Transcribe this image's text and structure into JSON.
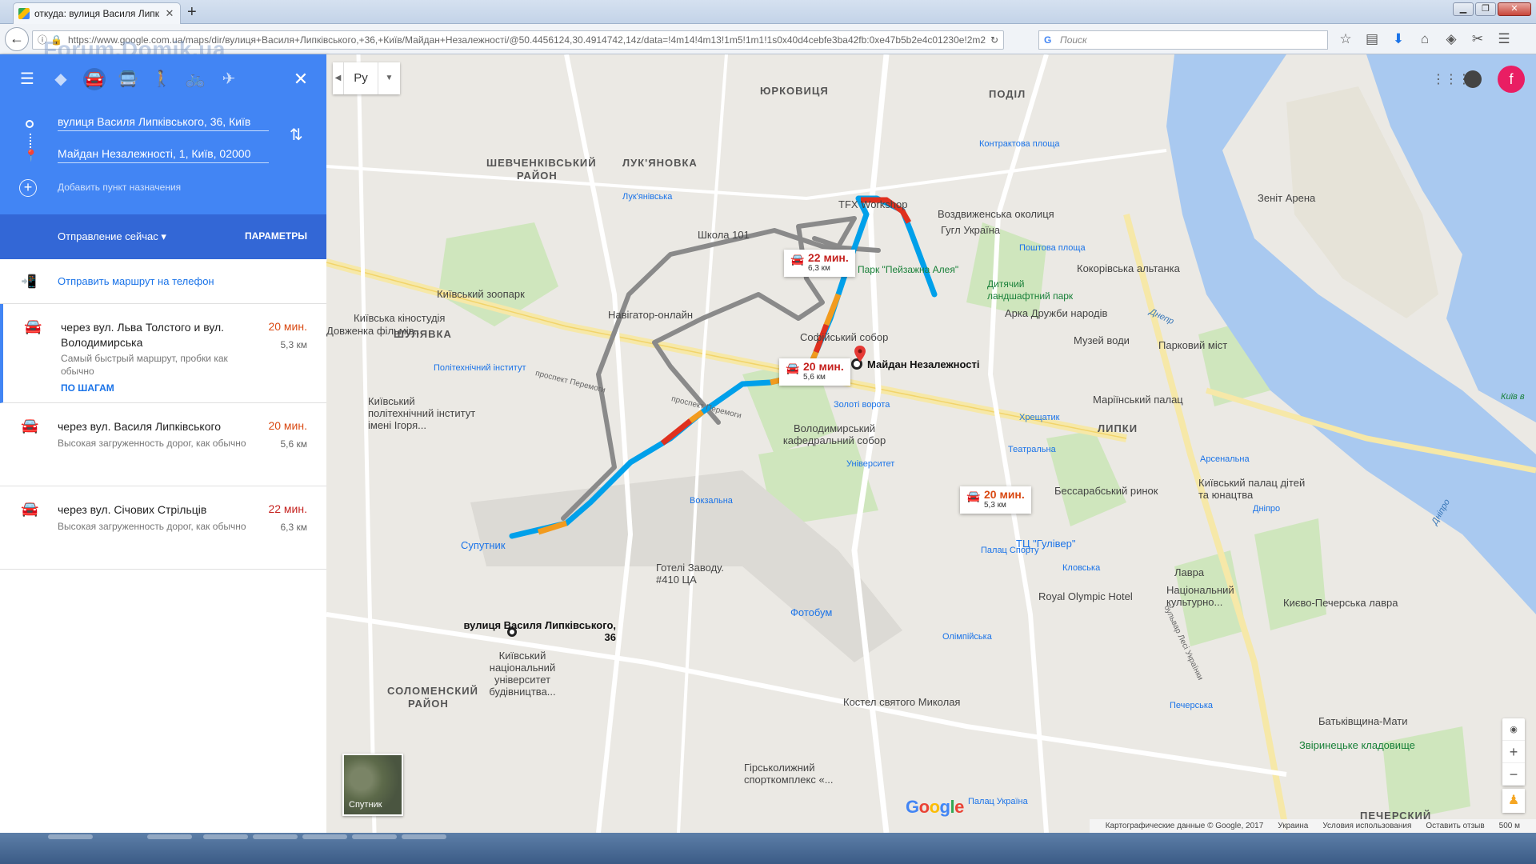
{
  "browser": {
    "tab_title": "откуда: вулиця Василя Липк",
    "url": "https://www.google.com.ua/maps/dir/вулиця+Василя+Липківського,+36,+Київ/Майдан+Незалежності/@50.4456124,30.4914742,14z/data=!4m14!4m13!1m5!1m1!1s0x40d4cebfe3ba42fb:0xe47b5b2e4c01230e!2m2!1d",
    "search_placeholder": "Поиск",
    "watermark": "Forum.Domik.ua"
  },
  "directions": {
    "origin": "вулиця Василя Липківського, 36, Київ",
    "destination": "Майдан Незалежності, 1, Київ, 02000",
    "add_destination": "Добавить пункт назначения",
    "depart": "Отправление сейчас",
    "options": "ПАРАМЕТРЫ",
    "send_to_phone": "Отправить маршрут на телефон",
    "routes": [
      {
        "name": "через вул. Льва Толстого и вул. Володимирська",
        "time": "20 мин.",
        "distance": "5,3 км",
        "desc": "Самый быстрый маршрут, пробки как обычно",
        "steps": "ПО ШАГАМ"
      },
      {
        "name": "через вул. Василя Липківського",
        "time": "20 мин.",
        "distance": "5,6 км",
        "desc": "Высокая загруженность дорог, как обычно"
      },
      {
        "name": "через вул. Січових Стрільців",
        "time": "22 мин.",
        "distance": "6,3 км",
        "desc": "Высокая загруженность дорог, как обычно"
      }
    ]
  },
  "map": {
    "language": "Ру",
    "avatar_letter": "f",
    "satellite_label": "Спутник",
    "google": [
      "G",
      "o",
      "o",
      "g",
      "l",
      "e"
    ],
    "footer": [
      "Картографические данные © Google, 2017",
      "Украина",
      "Условия использования",
      "Оставить отзыв",
      "500 м"
    ],
    "callouts": [
      {
        "time": "22 мин.",
        "dist": "6,3 км",
        "red": true
      },
      {
        "time": "20 мин.",
        "dist": "5,6 км",
        "red": true
      },
      {
        "time": "20 мин.",
        "dist": "5,3 км",
        "red": false
      }
    ],
    "labels": {
      "yurkovytsia": "ЮРКОВИЦЯ",
      "podil": "ПОДІЛ",
      "shevchenkivskyi": "ШЕВЧЕНКІВСЬКИЙ",
      "raion1": "РАЙОН",
      "lukianivka": "ЛУК'ЯНОВКА",
      "shuliavka": "ШУЛЯВКА",
      "lypky": "ЛИПКИ",
      "pecherskyi": "ПЕЧЕРСКИЙ",
      "solomianskyi": "СОЛОМЕНСКИЙ",
      "raion2": "РАЙОН",
      "start": "вулиця Василя Липківського, 36",
      "end": "Майдан Незалежності",
      "zoo": "Київський зоопарк",
      "kpi": "Київський політехнічний інститут імені Ігоря...",
      "kinostudio": "Київська кіностудія",
      "dovzhenko": "Довженка фільмів...",
      "school101": "Школа 101",
      "navigator": "Навігатор-онлайн",
      "tfx": "TFX Workshop",
      "vozdvyzh": "Воздвиженська околиця",
      "gugl": "Гугл Україна",
      "kontrakt": "Контрактова площа",
      "zenit": "Зеніт Арена",
      "park": "Парк \"Пейзажна Алея\"",
      "dytiachyi": "Дитячий ландшафтний парк",
      "arka": "Арка Дружби народів",
      "kokorivska": "Кокорівська альтанка",
      "poshtova": "Поштова площа",
      "sofia": "Софійський собор",
      "muzei": "Музей води",
      "parkmist": "Парковий міст",
      "zoloti": "Золоті ворота",
      "mariinsk": "Маріїнський палац",
      "khreschatyk": "Хрещатик",
      "volodsobor": "Володимирський кафедральний собор",
      "universytet": "Університет",
      "teatralna": "Театральна",
      "bessarab": "Бессарабський ринок",
      "arsenalna": "Арсенальна",
      "kyivpalace": "Київський палац дітей та юнацтва",
      "dnipro_st": "Дніпро",
      "vokzalna": "Вокзальна",
      "suputnyk": "Супутник",
      "gotel": "Готелі Заводу. #410 ЦА",
      "gulliver": "ТЦ \"Гулівер\"",
      "palaz": "Палац Спорту",
      "kluvy": "Кловська",
      "lavra": "Лавра",
      "natkult": "Національний культурно...",
      "royal": "Royal Olympic Hotel",
      "kyevopech": "Києво-Печерська лавра",
      "fotobum": "Фотобум",
      "olimpiiska": "Олімпійська",
      "kyivnat": "Київський національний університет будівництва...",
      "kostel": "Костел святого Миколая",
      "pecherska": "Печерська",
      "batkiv": "Батьківщина-Мати",
      "zvirynets": "Звіринецьке кладовище",
      "girsko": "Гірськолижний спорткомплекс «...",
      "palats_ukr": "Палац Україна",
      "politekh": "Політехнічний інститут",
      "lukianivska": "Лук'янівська",
      "dnepr": "Днепр",
      "dnipro_r": "Дніпро",
      "bulv": "бульвар Лесі Українки",
      "perem": "проспект Перемоги",
      "perem2": "проспект Перемоги",
      "kyiv_v": "Київ в"
    }
  }
}
